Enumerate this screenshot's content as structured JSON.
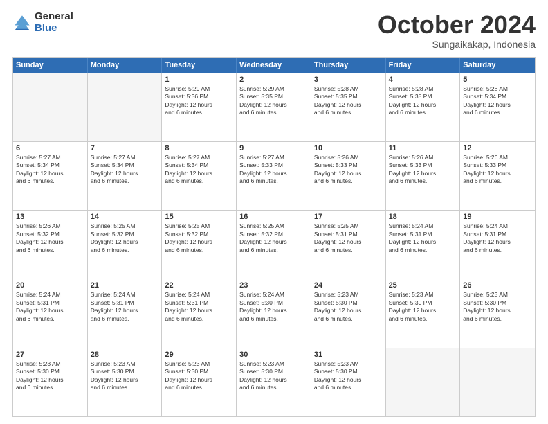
{
  "logo": {
    "general": "General",
    "blue": "Blue"
  },
  "title": "October 2024",
  "subtitle": "Sungaikakap, Indonesia",
  "days": [
    "Sunday",
    "Monday",
    "Tuesday",
    "Wednesday",
    "Thursday",
    "Friday",
    "Saturday"
  ],
  "rows": [
    [
      {
        "day": "",
        "empty": true,
        "lines": []
      },
      {
        "day": "",
        "empty": true,
        "lines": []
      },
      {
        "day": "1",
        "empty": false,
        "lines": [
          "Sunrise: 5:29 AM",
          "Sunset: 5:36 PM",
          "Daylight: 12 hours",
          "and 6 minutes."
        ]
      },
      {
        "day": "2",
        "empty": false,
        "lines": [
          "Sunrise: 5:29 AM",
          "Sunset: 5:35 PM",
          "Daylight: 12 hours",
          "and 6 minutes."
        ]
      },
      {
        "day": "3",
        "empty": false,
        "lines": [
          "Sunrise: 5:28 AM",
          "Sunset: 5:35 PM",
          "Daylight: 12 hours",
          "and 6 minutes."
        ]
      },
      {
        "day": "4",
        "empty": false,
        "lines": [
          "Sunrise: 5:28 AM",
          "Sunset: 5:35 PM",
          "Daylight: 12 hours",
          "and 6 minutes."
        ]
      },
      {
        "day": "5",
        "empty": false,
        "lines": [
          "Sunrise: 5:28 AM",
          "Sunset: 5:34 PM",
          "Daylight: 12 hours",
          "and 6 minutes."
        ]
      }
    ],
    [
      {
        "day": "6",
        "empty": false,
        "lines": [
          "Sunrise: 5:27 AM",
          "Sunset: 5:34 PM",
          "Daylight: 12 hours",
          "and 6 minutes."
        ]
      },
      {
        "day": "7",
        "empty": false,
        "lines": [
          "Sunrise: 5:27 AM",
          "Sunset: 5:34 PM",
          "Daylight: 12 hours",
          "and 6 minutes."
        ]
      },
      {
        "day": "8",
        "empty": false,
        "lines": [
          "Sunrise: 5:27 AM",
          "Sunset: 5:34 PM",
          "Daylight: 12 hours",
          "and 6 minutes."
        ]
      },
      {
        "day": "9",
        "empty": false,
        "lines": [
          "Sunrise: 5:27 AM",
          "Sunset: 5:33 PM",
          "Daylight: 12 hours",
          "and 6 minutes."
        ]
      },
      {
        "day": "10",
        "empty": false,
        "lines": [
          "Sunrise: 5:26 AM",
          "Sunset: 5:33 PM",
          "Daylight: 12 hours",
          "and 6 minutes."
        ]
      },
      {
        "day": "11",
        "empty": false,
        "lines": [
          "Sunrise: 5:26 AM",
          "Sunset: 5:33 PM",
          "Daylight: 12 hours",
          "and 6 minutes."
        ]
      },
      {
        "day": "12",
        "empty": false,
        "lines": [
          "Sunrise: 5:26 AM",
          "Sunset: 5:33 PM",
          "Daylight: 12 hours",
          "and 6 minutes."
        ]
      }
    ],
    [
      {
        "day": "13",
        "empty": false,
        "lines": [
          "Sunrise: 5:26 AM",
          "Sunset: 5:32 PM",
          "Daylight: 12 hours",
          "and 6 minutes."
        ]
      },
      {
        "day": "14",
        "empty": false,
        "lines": [
          "Sunrise: 5:25 AM",
          "Sunset: 5:32 PM",
          "Daylight: 12 hours",
          "and 6 minutes."
        ]
      },
      {
        "day": "15",
        "empty": false,
        "lines": [
          "Sunrise: 5:25 AM",
          "Sunset: 5:32 PM",
          "Daylight: 12 hours",
          "and 6 minutes."
        ]
      },
      {
        "day": "16",
        "empty": false,
        "lines": [
          "Sunrise: 5:25 AM",
          "Sunset: 5:32 PM",
          "Daylight: 12 hours",
          "and 6 minutes."
        ]
      },
      {
        "day": "17",
        "empty": false,
        "lines": [
          "Sunrise: 5:25 AM",
          "Sunset: 5:31 PM",
          "Daylight: 12 hours",
          "and 6 minutes."
        ]
      },
      {
        "day": "18",
        "empty": false,
        "lines": [
          "Sunrise: 5:24 AM",
          "Sunset: 5:31 PM",
          "Daylight: 12 hours",
          "and 6 minutes."
        ]
      },
      {
        "day": "19",
        "empty": false,
        "lines": [
          "Sunrise: 5:24 AM",
          "Sunset: 5:31 PM",
          "Daylight: 12 hours",
          "and 6 minutes."
        ]
      }
    ],
    [
      {
        "day": "20",
        "empty": false,
        "lines": [
          "Sunrise: 5:24 AM",
          "Sunset: 5:31 PM",
          "Daylight: 12 hours",
          "and 6 minutes."
        ]
      },
      {
        "day": "21",
        "empty": false,
        "lines": [
          "Sunrise: 5:24 AM",
          "Sunset: 5:31 PM",
          "Daylight: 12 hours",
          "and 6 minutes."
        ]
      },
      {
        "day": "22",
        "empty": false,
        "lines": [
          "Sunrise: 5:24 AM",
          "Sunset: 5:31 PM",
          "Daylight: 12 hours",
          "and 6 minutes."
        ]
      },
      {
        "day": "23",
        "empty": false,
        "lines": [
          "Sunrise: 5:24 AM",
          "Sunset: 5:30 PM",
          "Daylight: 12 hours",
          "and 6 minutes."
        ]
      },
      {
        "day": "24",
        "empty": false,
        "lines": [
          "Sunrise: 5:23 AM",
          "Sunset: 5:30 PM",
          "Daylight: 12 hours",
          "and 6 minutes."
        ]
      },
      {
        "day": "25",
        "empty": false,
        "lines": [
          "Sunrise: 5:23 AM",
          "Sunset: 5:30 PM",
          "Daylight: 12 hours",
          "and 6 minutes."
        ]
      },
      {
        "day": "26",
        "empty": false,
        "lines": [
          "Sunrise: 5:23 AM",
          "Sunset: 5:30 PM",
          "Daylight: 12 hours",
          "and 6 minutes."
        ]
      }
    ],
    [
      {
        "day": "27",
        "empty": false,
        "lines": [
          "Sunrise: 5:23 AM",
          "Sunset: 5:30 PM",
          "Daylight: 12 hours",
          "and 6 minutes."
        ]
      },
      {
        "day": "28",
        "empty": false,
        "lines": [
          "Sunrise: 5:23 AM",
          "Sunset: 5:30 PM",
          "Daylight: 12 hours",
          "and 6 minutes."
        ]
      },
      {
        "day": "29",
        "empty": false,
        "lines": [
          "Sunrise: 5:23 AM",
          "Sunset: 5:30 PM",
          "Daylight: 12 hours",
          "and 6 minutes."
        ]
      },
      {
        "day": "30",
        "empty": false,
        "lines": [
          "Sunrise: 5:23 AM",
          "Sunset: 5:30 PM",
          "Daylight: 12 hours",
          "and 6 minutes."
        ]
      },
      {
        "day": "31",
        "empty": false,
        "lines": [
          "Sunrise: 5:23 AM",
          "Sunset: 5:30 PM",
          "Daylight: 12 hours",
          "and 6 minutes."
        ]
      },
      {
        "day": "",
        "empty": true,
        "lines": []
      },
      {
        "day": "",
        "empty": true,
        "lines": []
      }
    ]
  ]
}
